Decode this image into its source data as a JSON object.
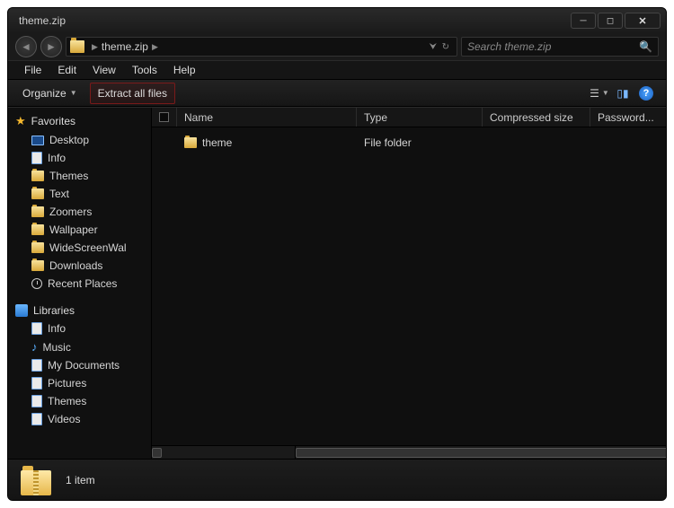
{
  "window": {
    "title": "theme.zip"
  },
  "breadcrumb": {
    "current": "theme.zip"
  },
  "search": {
    "placeholder": "Search theme.zip"
  },
  "menubar": [
    "File",
    "Edit",
    "View",
    "Tools",
    "Help"
  ],
  "toolbar": {
    "organize": "Organize",
    "extract": "Extract all files"
  },
  "sidebar": {
    "favorites": {
      "label": "Favorites",
      "items": [
        {
          "label": "Desktop",
          "icon": "monitor"
        },
        {
          "label": "Info",
          "icon": "page"
        },
        {
          "label": "Themes",
          "icon": "folder"
        },
        {
          "label": "Text",
          "icon": "folder"
        },
        {
          "label": "Zoomers",
          "icon": "folder"
        },
        {
          "label": "Wallpaper",
          "icon": "folder"
        },
        {
          "label": "WideScreenWal",
          "icon": "folder"
        },
        {
          "label": "Downloads",
          "icon": "folder"
        },
        {
          "label": "Recent Places",
          "icon": "clock"
        }
      ]
    },
    "libraries": {
      "label": "Libraries",
      "items": [
        {
          "label": "Info",
          "icon": "page"
        },
        {
          "label": "Music",
          "icon": "note"
        },
        {
          "label": "My Documents",
          "icon": "page"
        },
        {
          "label": "Pictures",
          "icon": "page"
        },
        {
          "label": "Themes",
          "icon": "page"
        },
        {
          "label": "Videos",
          "icon": "page"
        }
      ]
    }
  },
  "columns": {
    "name": "Name",
    "type": "Type",
    "csize": "Compressed size",
    "pwd": "Password..."
  },
  "files": [
    {
      "name": "theme",
      "type": "File folder"
    }
  ],
  "statusbar": {
    "text": "1 item"
  }
}
